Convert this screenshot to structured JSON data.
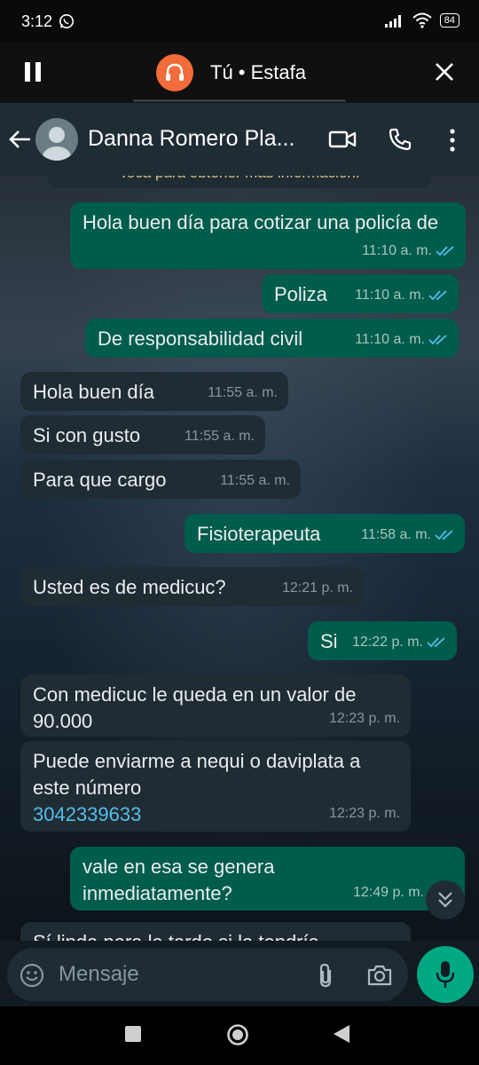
{
  "status": {
    "time": "3:12",
    "battery": "84"
  },
  "call": {
    "title": "Tú • Estafa"
  },
  "header": {
    "contact_name": "Danna Romero Pla..."
  },
  "chat": {
    "notice": "Toca para obtener más información.",
    "messages": [
      {
        "dir": "out",
        "text": "Hola buen día para cotizar una policía de",
        "time": "11:10 a. m."
      },
      {
        "dir": "out",
        "text": "Poliza",
        "time": "11:10 a. m."
      },
      {
        "dir": "out",
        "text": "De responsabilidad civil",
        "time": "11:10 a. m."
      },
      {
        "dir": "in",
        "text": "Hola buen día",
        "time": "11:55 a. m."
      },
      {
        "dir": "in",
        "text": "Si con gusto",
        "time": "11:55 a. m."
      },
      {
        "dir": "in",
        "text": "Para que cargo",
        "time": "11:55 a. m."
      },
      {
        "dir": "out",
        "text": "Fisioterapeuta",
        "time": "11:58 a. m."
      },
      {
        "dir": "in",
        "text": "Usted es de medicuc?",
        "time": "12:21 p. m."
      },
      {
        "dir": "out",
        "text": "Si",
        "time": "12:22 p. m."
      },
      {
        "dir": "in",
        "text": "Con medicuc le queda en un valor de 90.000",
        "time": "12:23 p. m."
      },
      {
        "dir": "in",
        "text": "Puede enviarme a nequi o daviplata a este número",
        "link": "3042339633",
        "time": "12:23 p. m."
      },
      {
        "dir": "out",
        "text": "vale  en esa se genera inmediatamente?",
        "time": "12:49 p. m."
      },
      {
        "dir": "in",
        "text": "Sí linda para la tarde si la tendría",
        "time": ""
      }
    ]
  },
  "input": {
    "placeholder": "Mensaje"
  },
  "colors": {
    "outgoing": "#005c4b",
    "incoming": "#202c33",
    "accent": "#00a884",
    "call": "#f26b3a",
    "read_tick": "#53bdeb"
  }
}
